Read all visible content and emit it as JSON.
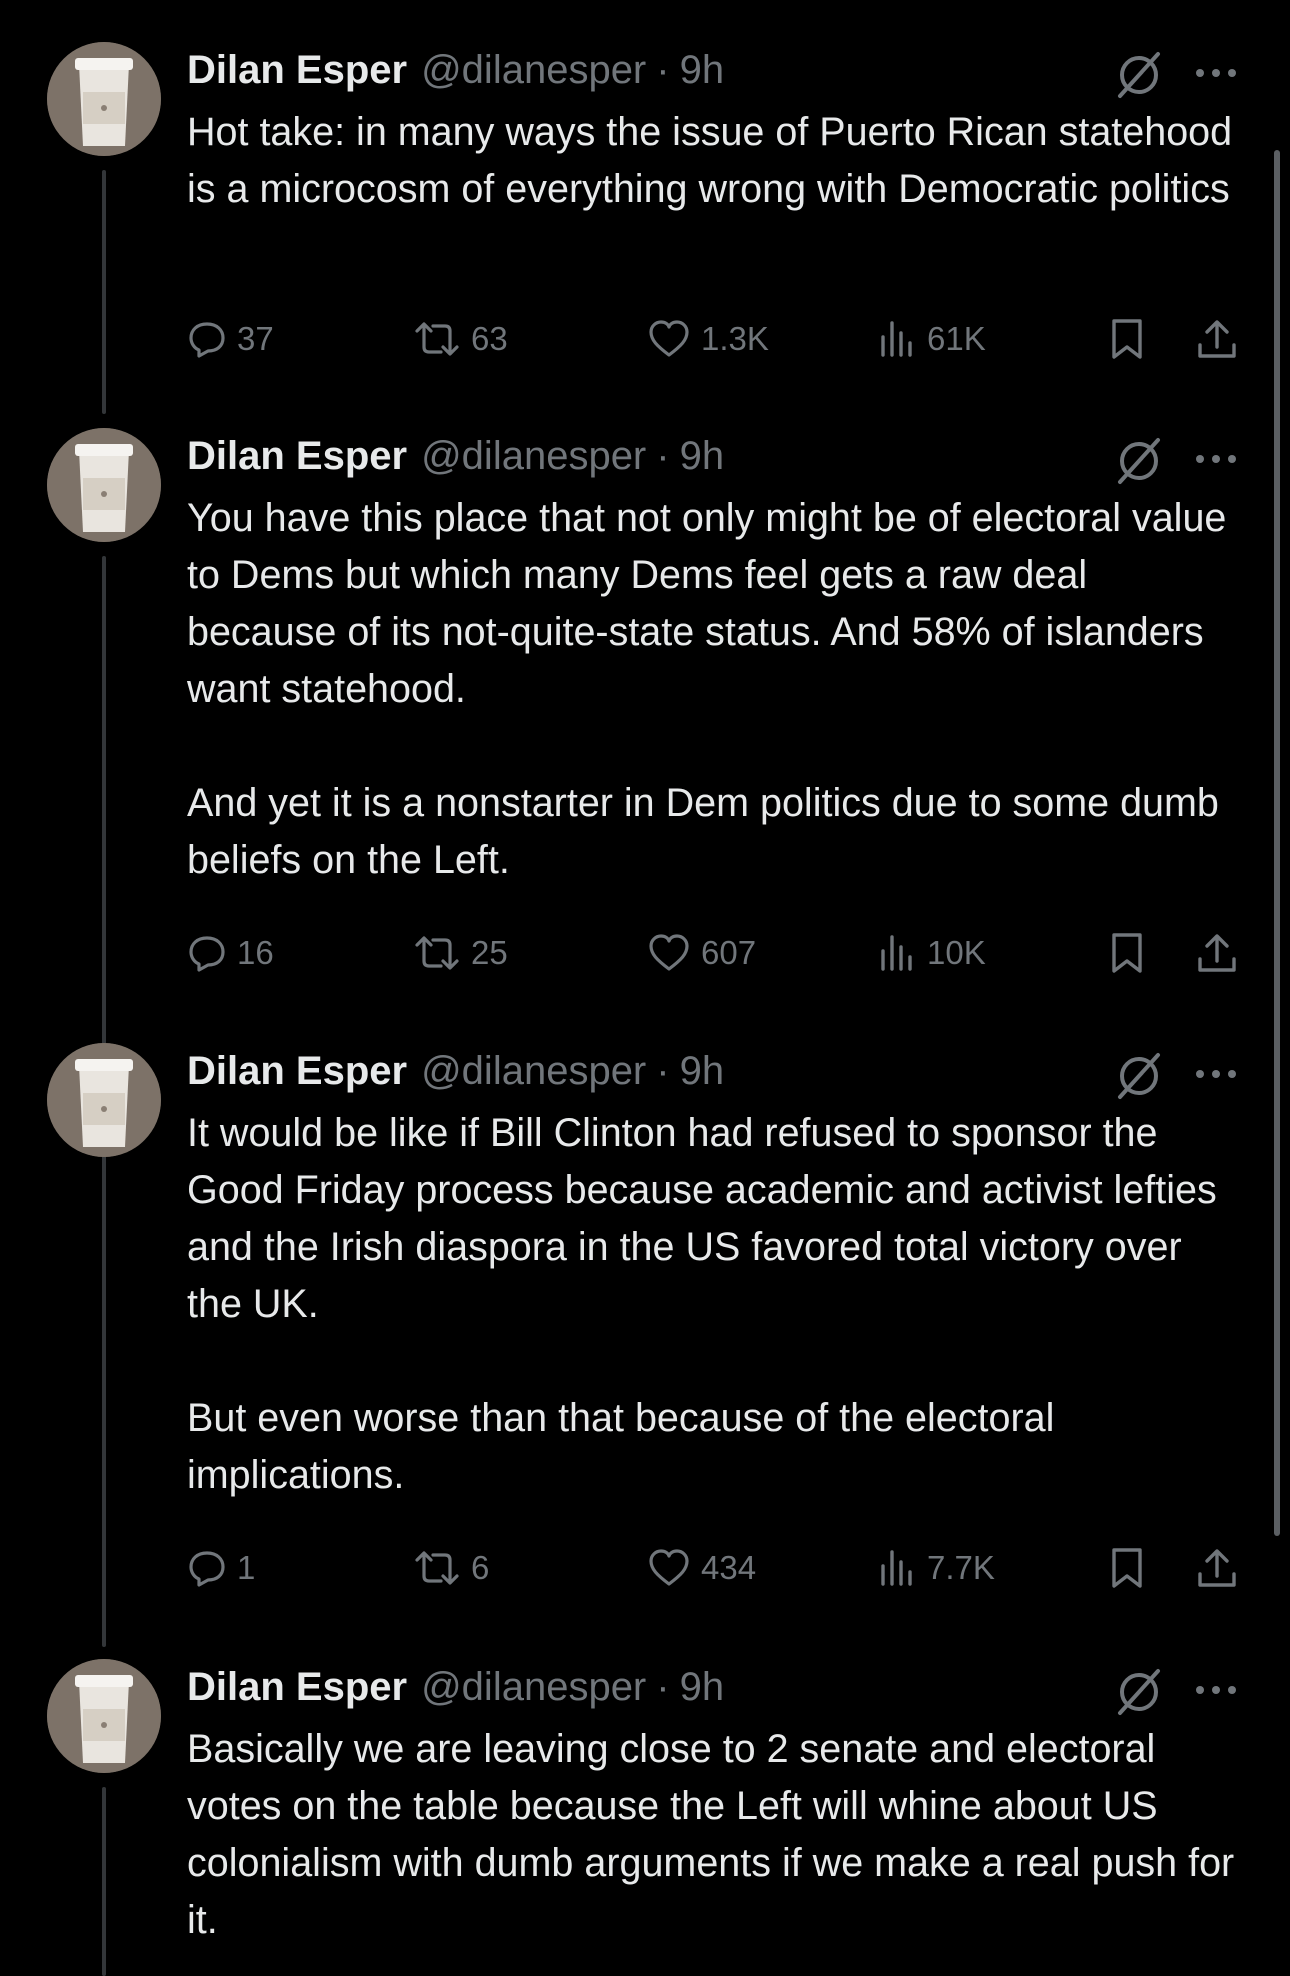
{
  "author": {
    "name": "Dilan Esper",
    "handle": "@dilanesper",
    "separator": "·"
  },
  "colors": {
    "background": "#000000",
    "text": "#e7e9ea",
    "muted": "#71767b",
    "thread_line": "#333639"
  },
  "icons": {
    "grok": "grok-icon",
    "more": "more-icon",
    "reply": "reply-icon",
    "retweet": "retweet-icon",
    "like": "heart-icon",
    "views": "views-icon",
    "bookmark": "bookmark-icon",
    "share": "share-icon"
  },
  "tweets": [
    {
      "time": "9h",
      "paragraphs": [
        "Hot take: in many ways the issue of Puerto Rican statehood is a microcosm of everything wrong with Democratic politics"
      ],
      "replies": "37",
      "retweets": "63",
      "likes": "1.3K",
      "views": "61K"
    },
    {
      "time": "9h",
      "paragraphs": [
        "You have this place that not only might be of electoral value to Dems but which many Dems feel gets a raw deal because of its not-quite-state status. And 58% of islanders want statehood.",
        "And yet it is a nonstarter in Dem politics due to some dumb beliefs on the Left."
      ],
      "replies": "16",
      "retweets": "25",
      "likes": "607",
      "views": "10K"
    },
    {
      "time": "9h",
      "paragraphs": [
        "It would be like if Bill Clinton had refused to sponsor the Good Friday process because academic and activist lefties and the Irish diaspora in the US favored total victory over the UK.",
        "But even worse than that because of the electoral implications."
      ],
      "replies": "1",
      "retweets": "6",
      "likes": "434",
      "views": "7.7K"
    },
    {
      "time": "9h",
      "paragraphs": [
        "Basically we are leaving close to 2 senate and electoral votes on the table because the Left will whine about US colonialism with dumb arguments if we make a real push for it."
      ]
    }
  ]
}
